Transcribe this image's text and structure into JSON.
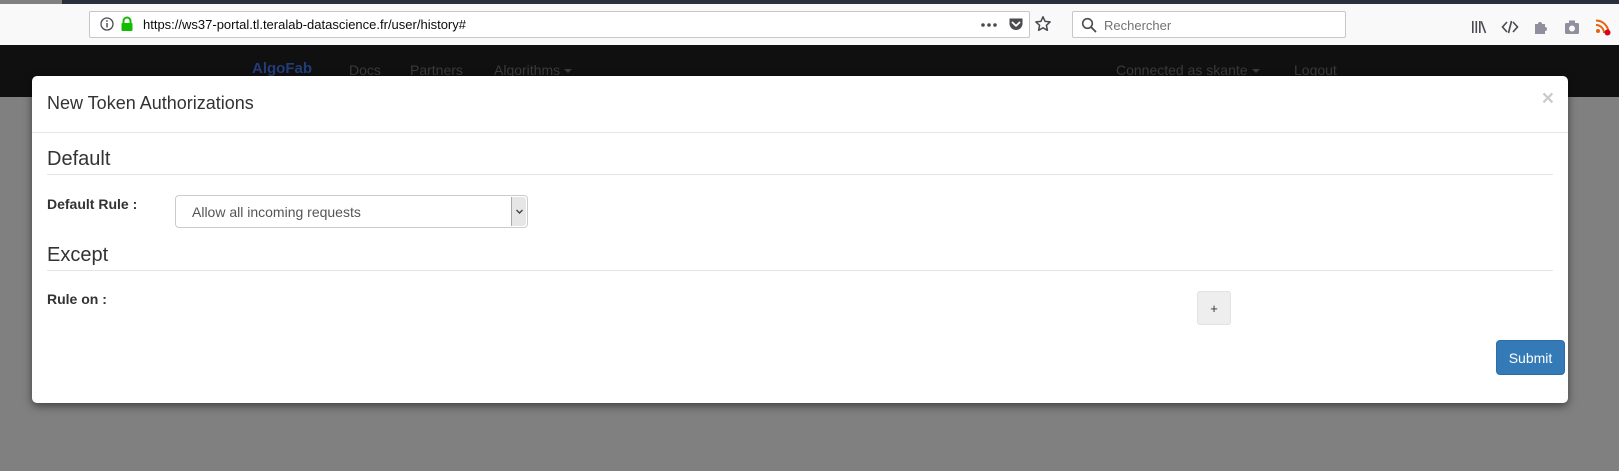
{
  "browser": {
    "url": "https://ws37-portal.tl.teralab-datascience.fr/user/history#",
    "search_placeholder": "Rechercher"
  },
  "navbar": {
    "brand": "AlgoFab",
    "items": [
      "Docs",
      "Partners",
      "Algorithms"
    ],
    "user": "Connected as skante",
    "logout": "Logout"
  },
  "modal": {
    "title": "New Token Authorizations",
    "close": "×",
    "default_section": "Default",
    "default_rule_label": "Default Rule :",
    "default_rule_value": "Allow all incoming requests",
    "except_section": "Except",
    "rule_on_label": "Rule on :",
    "add_label": "+",
    "submit_label": "Submit"
  }
}
